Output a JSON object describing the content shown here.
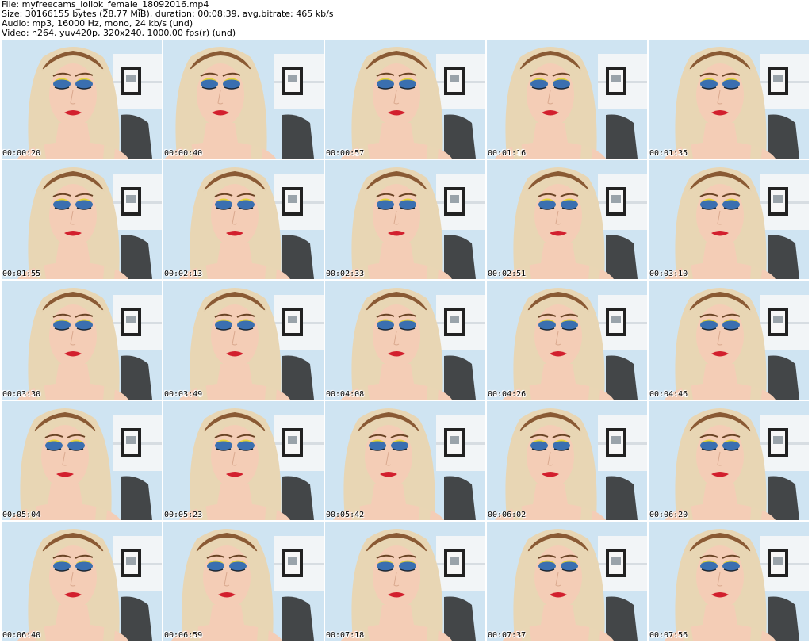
{
  "header": {
    "file": "File: myfreecams_lollok_female_18092016.mp4",
    "size": "Size: 30166155 bytes (28.77 MiB), duration: 00:08:39, avg.bitrate: 465 kb/s",
    "audio": "Audio: mp3, 16000 Hz, mono, 24 kb/s (und)",
    "video": "Video: h264, yuv420p, 320x240, 1000.00 fps(r) (und)"
  },
  "thumbnails": [
    {
      "time": "00:00:20",
      "pose": "center"
    },
    {
      "time": "00:00:40",
      "pose": "tilt"
    },
    {
      "time": "00:00:57",
      "pose": "center"
    },
    {
      "time": "00:01:16",
      "pose": "left"
    },
    {
      "time": "00:01:35",
      "pose": "center"
    },
    {
      "time": "00:01:55",
      "pose": "center"
    },
    {
      "time": "00:02:13",
      "pose": "center"
    },
    {
      "time": "00:02:33",
      "pose": "center"
    },
    {
      "time": "00:02:51",
      "pose": "center"
    },
    {
      "time": "00:03:10",
      "pose": "center"
    },
    {
      "time": "00:03:30",
      "pose": "center"
    },
    {
      "time": "00:03:49",
      "pose": "center"
    },
    {
      "time": "00:04:08",
      "pose": "center"
    },
    {
      "time": "00:04:26",
      "pose": "center"
    },
    {
      "time": "00:04:46",
      "pose": "center"
    },
    {
      "time": "00:05:04",
      "pose": "left"
    },
    {
      "time": "00:05:23",
      "pose": "center"
    },
    {
      "time": "00:05:42",
      "pose": "left"
    },
    {
      "time": "00:06:02",
      "pose": "left"
    },
    {
      "time": "00:06:20",
      "pose": "center"
    },
    {
      "time": "00:06:40",
      "pose": "center"
    },
    {
      "time": "00:06:59",
      "pose": "left"
    },
    {
      "time": "00:07:18",
      "pose": "center"
    },
    {
      "time": "00:07:37",
      "pose": "center"
    },
    {
      "time": "00:07:56",
      "pose": "center"
    }
  ],
  "colors": {
    "wall": "#cfe4f2",
    "hair_dark": "#8a5a34",
    "hair_light": "#e8d6b4",
    "skin": "#f4cdb6",
    "lips": "#d2202e",
    "eyeshadow_blue": "#3a6fb0",
    "eyeshadow_yellow": "#e4d23a",
    "frame_black": "#222222",
    "shelf_white": "#f2f5f7"
  }
}
